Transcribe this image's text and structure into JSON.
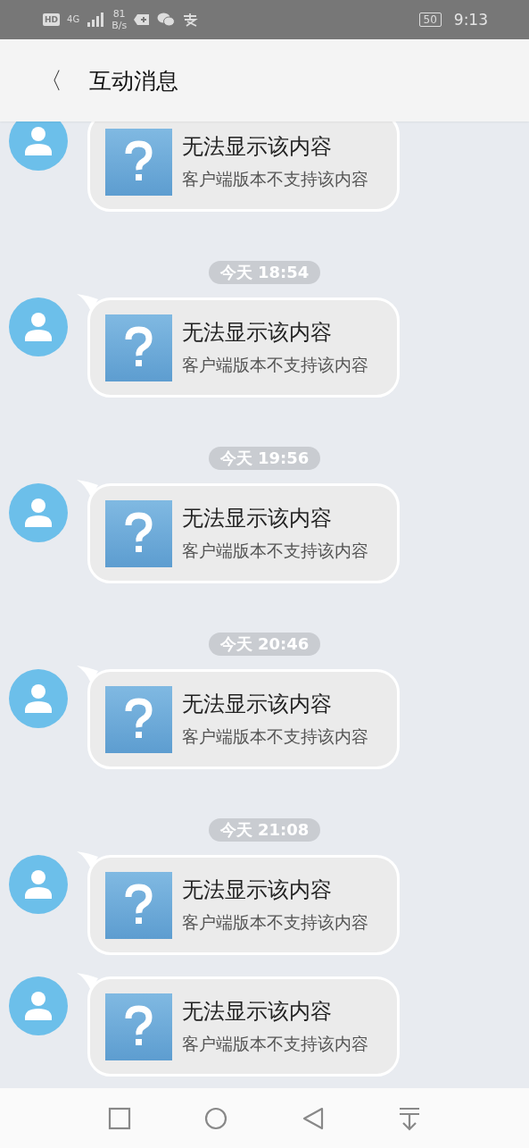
{
  "status_bar": {
    "hd": "HD",
    "network": "4G",
    "speed_value": "81",
    "speed_unit": "B/s",
    "battery": "50",
    "time": "9:13"
  },
  "header": {
    "back": "〈",
    "title": "互动消息"
  },
  "messages": [
    {
      "title": "无法显示该内容",
      "subtitle": "客户端版本不支持该内容"
    },
    {
      "timestamp": "今天 18:54",
      "title": "无法显示该内容",
      "subtitle": "客户端版本不支持该内容"
    },
    {
      "timestamp": "今天 19:56",
      "title": "无法显示该内容",
      "subtitle": "客户端版本不支持该内容"
    },
    {
      "timestamp": "今天 20:46",
      "title": "无法显示该内容",
      "subtitle": "客户端版本不支持该内容"
    },
    {
      "timestamp": "今天 21:08",
      "title": "无法显示该内容",
      "subtitle": "客户端版本不支持该内容"
    },
    {
      "title": "无法显示该内容",
      "subtitle": "客户端版本不支持该内容"
    }
  ]
}
